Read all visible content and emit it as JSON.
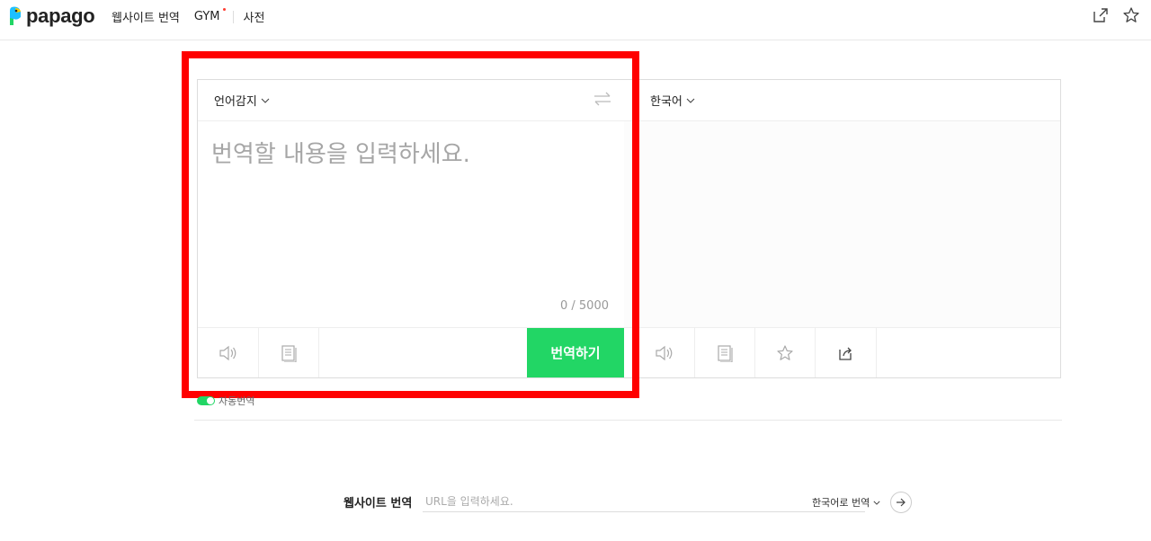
{
  "header": {
    "logo_text": "papago",
    "nav": {
      "website_translate": "웹사이트 번역",
      "gym": "GYM",
      "dictionary": "사전"
    },
    "icons": [
      "share-icon",
      "star-icon"
    ],
    "accent_dot_color": "#ff3b30"
  },
  "source": {
    "language": "언어감지",
    "placeholder": "번역할 내용을 입력하세요.",
    "counter": "0 / 5000",
    "translate_button": "번역하기",
    "translate_button_color": "#22d665"
  },
  "target": {
    "language": "한국어"
  },
  "auto_detect": {
    "label": "자동번역",
    "enabled": true
  },
  "website": {
    "label": "웹사이트 번역",
    "placeholder": "URL을 입력하세요.",
    "target_language": "한국어로 번역"
  },
  "highlight": {
    "color": "#ff0000"
  }
}
